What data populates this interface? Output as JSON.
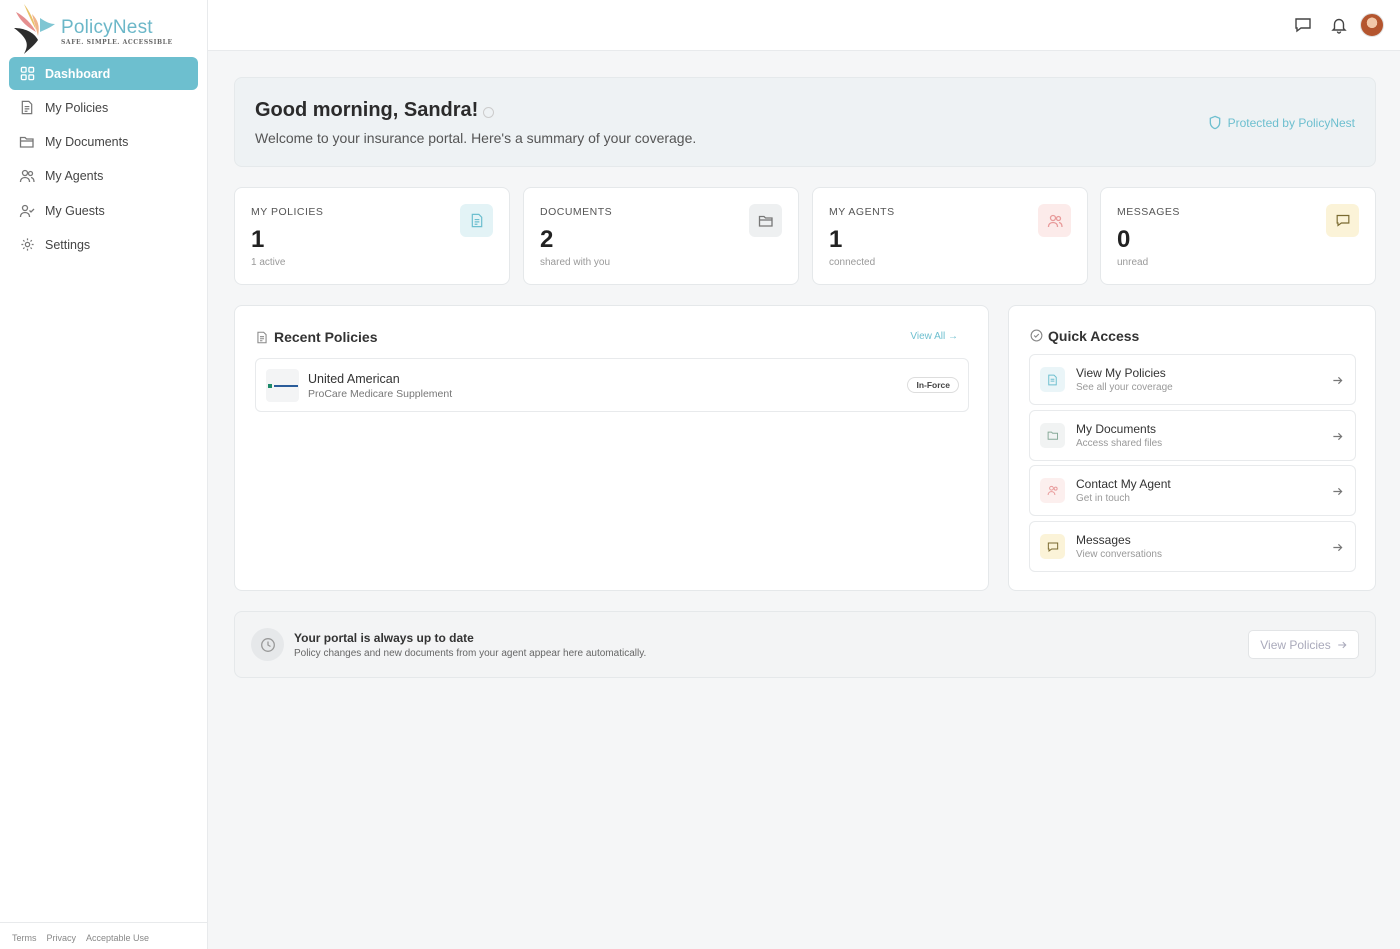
{
  "brand": {
    "name": "PolicyNest",
    "tagline": "SAFE. SIMPLE. ACCESSIBLE"
  },
  "sidebar": {
    "items": [
      {
        "label": "Dashboard",
        "icon": "grid-icon",
        "active": true
      },
      {
        "label": "My Policies",
        "icon": "document-icon"
      },
      {
        "label": "My Documents",
        "icon": "folder-icon"
      },
      {
        "label": "My Agents",
        "icon": "users-icon"
      },
      {
        "label": "My Guests",
        "icon": "user-check-icon"
      },
      {
        "label": "Settings",
        "icon": "gear-icon"
      }
    ],
    "footer": [
      "Terms",
      "Privacy",
      "Acceptable Use"
    ]
  },
  "topbar": {
    "icons": [
      "chat-icon",
      "bell-icon",
      "avatar"
    ]
  },
  "welcome": {
    "greeting": "Good morning, Sandra!",
    "message": "Welcome to your insurance portal. Here's a summary of your coverage.",
    "protected": "Protected by PolicyNest"
  },
  "stats": [
    {
      "label": "MY POLICIES",
      "value": "1",
      "sub": "1 active",
      "icon": "document-icon",
      "color": "#6dbfcf"
    },
    {
      "label": "DOCUMENTS",
      "value": "2",
      "sub": "shared with you",
      "icon": "folder-icon",
      "color": "#777777"
    },
    {
      "label": "MY AGENTS",
      "value": "1",
      "sub": "connected",
      "icon": "users-icon",
      "color": "#e89a9a"
    },
    {
      "label": "MESSAGES",
      "value": "0",
      "sub": "unread",
      "icon": "chat-icon",
      "color": "#a08a3a"
    }
  ],
  "recent": {
    "title": "Recent Policies",
    "view_all": "View All",
    "policies": [
      {
        "carrier": "United American",
        "plan": "ProCare Medicare Supplement",
        "status": "In-Force"
      }
    ]
  },
  "quick_access": {
    "title": "Quick Access",
    "items": [
      {
        "title": "View My Policies",
        "subtitle": "See all your coverage",
        "icon": "document-icon"
      },
      {
        "title": "My Documents",
        "subtitle": "Access shared files",
        "icon": "folder-icon"
      },
      {
        "title": "Contact My Agent",
        "subtitle": "Get in touch",
        "icon": "users-icon"
      },
      {
        "title": "Messages",
        "subtitle": "View conversations",
        "icon": "chat-icon"
      }
    ]
  },
  "banner": {
    "title": "Your portal is always up to date",
    "subtitle": "Policy changes and new documents from your agent appear here automatically.",
    "button": "View Policies"
  }
}
